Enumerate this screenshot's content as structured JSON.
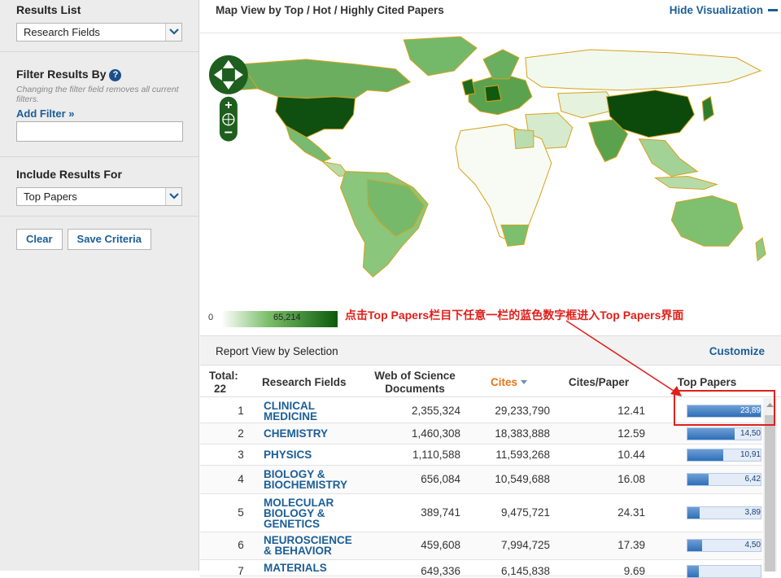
{
  "sidebar": {
    "results_list": {
      "title": "Results List",
      "selected": "Research Fields"
    },
    "filter": {
      "title": "Filter Results By",
      "help": "?",
      "note": "Changing the filter field removes all current filters.",
      "add_filter": "Add Filter »",
      "input_value": ""
    },
    "include": {
      "title": "Include Results For",
      "selected": "Top Papers"
    },
    "buttons": {
      "clear": "Clear",
      "save": "Save Criteria"
    }
  },
  "map_header": {
    "title": "Map View by Top / Hot / Highly Cited Papers",
    "hide": "Hide Visualization"
  },
  "legend": {
    "min": "0",
    "max": "65,214"
  },
  "annotation": "点击Top Papers栏目下任意一栏的蓝色数字框进入Top Papers界面",
  "report": {
    "title": "Report View by Selection",
    "customize": "Customize",
    "headers": {
      "total": "Total:",
      "total_count": "22",
      "field": "Research Fields",
      "docs": "Web of Science Documents",
      "cites": "Cites",
      "cpp": "Cites/Paper",
      "tp": "Top Papers"
    },
    "rows": [
      {
        "rank": "1",
        "field": "CLINICAL MEDICINE",
        "docs": "2,355,324",
        "cites": "29,233,790",
        "cpp": "12.41",
        "tp": "23,89",
        "tp_level": 1.0
      },
      {
        "rank": "2",
        "field": "CHEMISTRY",
        "docs": "1,460,308",
        "cites": "18,383,888",
        "cpp": "12.59",
        "tp": "14,50",
        "tp_level": 0.64
      },
      {
        "rank": "3",
        "field": "PHYSICS",
        "docs": "1,110,588",
        "cites": "11,593,268",
        "cpp": "10.44",
        "tp": "10,91",
        "tp_level": 0.49
      },
      {
        "rank": "4",
        "field": "BIOLOGY & BIOCHEMISTRY",
        "docs": "656,084",
        "cites": "10,549,688",
        "cpp": "16.08",
        "tp": "6,42",
        "tp_level": 0.29
      },
      {
        "rank": "5",
        "field": "MOLECULAR BIOLOGY & GENETICS",
        "docs": "389,741",
        "cites": "9,475,721",
        "cpp": "24.31",
        "tp": "3,89",
        "tp_level": 0.17
      },
      {
        "rank": "6",
        "field": "NEUROSCIENCE & BEHAVIOR",
        "docs": "459,608",
        "cites": "7,994,725",
        "cpp": "17.39",
        "tp": "4,50",
        "tp_level": 0.2
      },
      {
        "rank": "7",
        "field": "MATERIALS",
        "docs": "649,336",
        "cites": "6,145,838",
        "cpp": "9.69",
        "tp": "",
        "tp_level": 0.15
      }
    ]
  },
  "colors": {
    "link": "#1b5e97",
    "accent_red": "#e0201b",
    "map_dark": "#0b5a0b"
  }
}
